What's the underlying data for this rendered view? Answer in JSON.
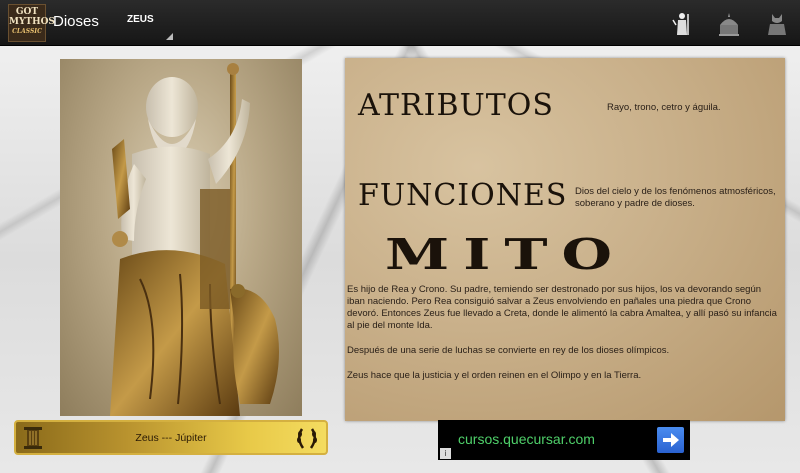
{
  "actionbar": {
    "logo_line1": "GOT",
    "logo_line2": "MYTHOS",
    "logo_line3": "CLASSIC",
    "title": "Dioses",
    "spinner_value": "ZEUS",
    "icons": [
      "zeus-statue-icon",
      "temple-icon",
      "bust-icon"
    ]
  },
  "content": {
    "atributos_heading": "ATRIBUTOS",
    "atributos_text": "Rayo, trono, cetro y águila.",
    "funciones_heading": "FUNCIONES",
    "funciones_text": "Dios del cielo y de los fenómenos atmosféricos, soberano y padre de dioses.",
    "mito_heading": "MITO",
    "mito_paragraphs": [
      "Es hijo de Rea y Crono. Su padre, temiendo ser destronado por sus hijos, los va devorando según iban naciendo. Pero Rea consiguió salvar a Zeus envolviendo en pañales una piedra que Crono devoró. Entonces Zeus fue llevado a Creta, donde le alimentó la cabra Amaltea, y allí pasó su infancia al pie del monte Ida.",
      "Después de una serie de luchas se convierte en rey de los dioses olímpicos.",
      "Zeus hace que la justicia y el orden reinen en el Olimpo y en la Tierra."
    ]
  },
  "namebar": {
    "label": "Zeus --- Júpiter"
  },
  "ad": {
    "text": "cursos.quecursar.com",
    "info_label": "i"
  },
  "colors": {
    "ad_text": "#4fd06a",
    "ad_button": "#2a62d0",
    "gold": "#e8c948"
  }
}
